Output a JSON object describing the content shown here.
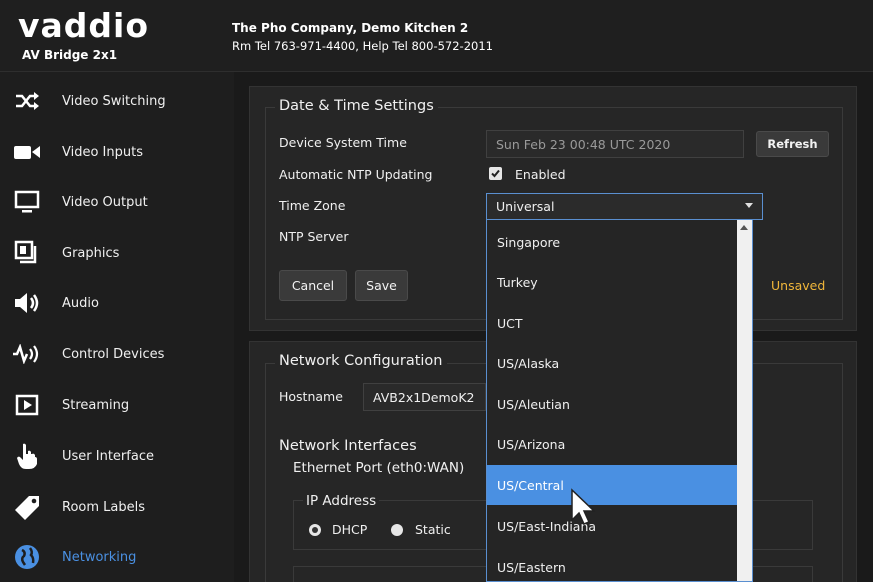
{
  "header": {
    "logo": "vaddio",
    "product": "AV Bridge 2x1",
    "company": "The Pho Company, Demo Kitchen 2",
    "contact": "Rm Tel 763-971-4400, Help Tel 800-572-2011"
  },
  "sidebar": {
    "items": [
      {
        "label": "Video Switching",
        "icon": "video-switching-icon"
      },
      {
        "label": "Video Inputs",
        "icon": "video-camera-icon"
      },
      {
        "label": "Video Output",
        "icon": "monitor-icon"
      },
      {
        "label": "Graphics",
        "icon": "graphics-icon"
      },
      {
        "label": "Audio",
        "icon": "speaker-icon"
      },
      {
        "label": "Control Devices",
        "icon": "control-devices-icon"
      },
      {
        "label": "Streaming",
        "icon": "play-icon"
      },
      {
        "label": "User Interface",
        "icon": "hand-pointer-icon"
      },
      {
        "label": "Room Labels",
        "icon": "tag-icon"
      },
      {
        "label": "Networking",
        "icon": "globe-icon",
        "active": true
      }
    ]
  },
  "datetime": {
    "title": "Date & Time Settings",
    "system_time_label": "Device System Time",
    "system_time_value": "Sun Feb 23 00:48 UTC 2020",
    "refresh_label": "Refresh",
    "ntp_label": "Automatic NTP Updating",
    "ntp_enabled_label": "Enabled",
    "ntp_enabled": true,
    "timezone_label": "Time Zone",
    "timezone_value": "Universal",
    "ntp_server_label": "NTP Server",
    "cancel_label": "Cancel",
    "save_label": "Save",
    "unsaved_label": "Unsaved"
  },
  "network": {
    "title": "Network Configuration",
    "hostname_label": "Hostname",
    "hostname_value": "AVB2x1DemoK2",
    "interfaces_label": "Network Interfaces",
    "ethernet_label": "Ethernet Port (eth0:WAN)",
    "ip_label": "IP Address",
    "dhcp_label": "DHCP",
    "static_label": "Static",
    "dhcp_selected": true
  },
  "timezone_dropdown": {
    "options": [
      "Singapore",
      "Turkey",
      "UCT",
      "US/Alaska",
      "US/Aleutian",
      "US/Arizona",
      "US/Central",
      "US/East-Indiana",
      "US/Eastern"
    ],
    "highlighted": "US/Central"
  },
  "colors": {
    "accent": "#4a90e2",
    "unsaved": "#f0b63a",
    "background": "#1a1a1a",
    "panel": "#262626"
  }
}
